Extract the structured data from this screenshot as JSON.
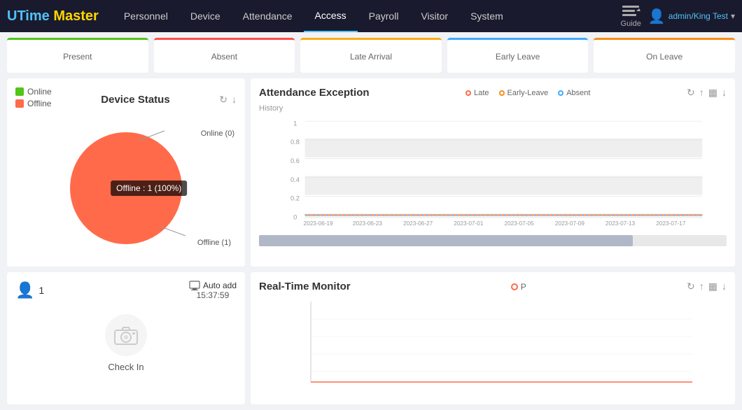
{
  "app": {
    "logo": {
      "u": "U",
      "time": "Time",
      "space": " ",
      "master": "Master"
    }
  },
  "nav": {
    "items": [
      {
        "label": "Personnel",
        "active": false
      },
      {
        "label": "Device",
        "active": false
      },
      {
        "label": "Attendance",
        "active": false
      },
      {
        "label": "Access",
        "active": true
      },
      {
        "label": "Payroll",
        "active": false
      },
      {
        "label": "Visitor",
        "active": false
      },
      {
        "label": "System",
        "active": false
      }
    ],
    "guide_label": "Guide"
  },
  "user": {
    "username": "admin/King Test",
    "avatar_char": "👤"
  },
  "summary_cards": [
    {
      "label": "Present",
      "type": "present"
    },
    {
      "label": "Absent",
      "type": "absent"
    },
    {
      "label": "Late Arrival",
      "type": "late"
    },
    {
      "label": "Early Leave",
      "type": "early-leave"
    },
    {
      "label": "On Leave",
      "type": "on-leave"
    }
  ],
  "device_status": {
    "title": "Device Status",
    "legend": [
      {
        "label": "Online",
        "type": "online"
      },
      {
        "label": "Offline",
        "type": "offline"
      }
    ],
    "online_label": "Online (0)",
    "offline_label": "Offline (1)",
    "tooltip": "Offline : 1 (100%)",
    "refresh_icon": "↻",
    "download_icon": "↓"
  },
  "attendance_exception": {
    "title": "Attendance Exception",
    "history_label": "History",
    "legend": [
      {
        "label": "Late",
        "type": "late"
      },
      {
        "label": "Early-Leave",
        "type": "early"
      },
      {
        "label": "Absent",
        "type": "absent"
      }
    ],
    "y_axis": [
      "1",
      "0.8",
      "0.6",
      "0.4",
      "0.2",
      "0"
    ],
    "x_axis": [
      "2023-06-19",
      "2023-06-23",
      "2023-06-27",
      "2023-07-01",
      "2023-07-05",
      "2023-07-09",
      "2023-07-13",
      "2023-07-17"
    ],
    "refresh_icon": "↻",
    "upload_icon": "↑",
    "bar_icon": "▦",
    "download_icon": "↓"
  },
  "checkin": {
    "count": "1",
    "auto_add_label": "Auto add",
    "auto_add_time": "15:37:59",
    "check_in_label": "Check In"
  },
  "realtime_monitor": {
    "title": "Real-Time Monitor",
    "legend_label": "P",
    "refresh_icon": "↻",
    "upload_icon": "↑",
    "bar_icon": "▦",
    "download_icon": "↓"
  }
}
